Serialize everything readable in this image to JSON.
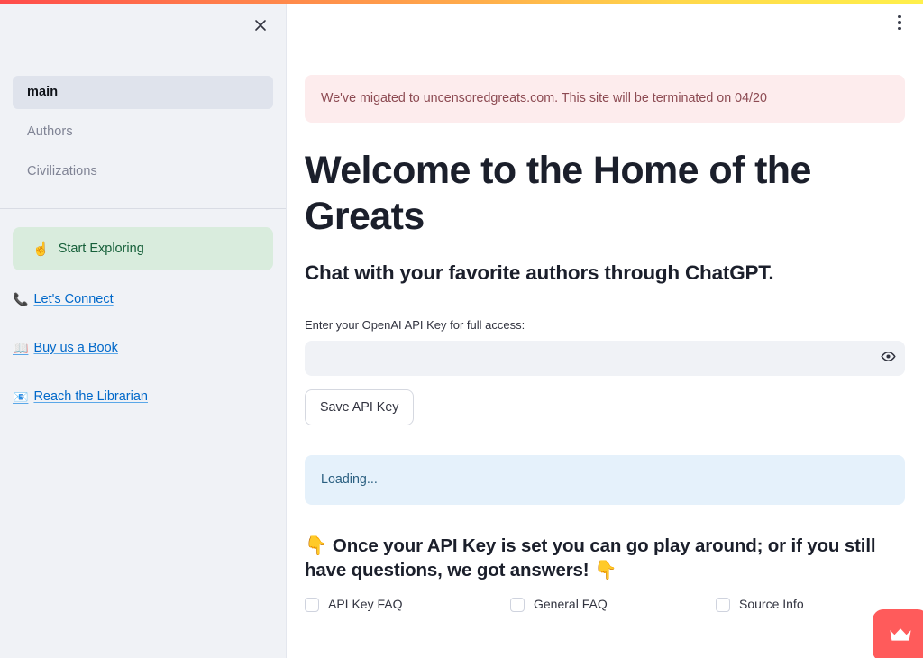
{
  "window": {
    "accent_gradient_start": "#ff4b4b",
    "accent_gradient_end": "#fff04b"
  },
  "sidebar": {
    "close_label": "×",
    "nav_items": [
      {
        "label": "main",
        "active": true
      },
      {
        "label": "Authors",
        "active": false
      },
      {
        "label": "Civilizations",
        "active": false
      }
    ],
    "success_box": {
      "emoji": "☝️",
      "text": "Start Exploring",
      "bg_color": "#d9ecdd",
      "text_color": "#17603a"
    },
    "links": [
      {
        "emoji": "📞",
        "label": "Let's Connect"
      },
      {
        "emoji": "📖",
        "label": "Buy us a Book"
      },
      {
        "emoji": "📧",
        "label": "Reach the Librarian"
      }
    ],
    "link_color": "#0068c9"
  },
  "main": {
    "menu_icon": "three-dots-vertical",
    "alert": {
      "text": "We've migated to uncensoredgreats.com. This site will be terminated on 04/20",
      "bg_color": "#fdeced",
      "text_color": "#8c4a52"
    },
    "title": "Welcome to the Home of the Greats",
    "subtitle": "Chat with your favorite authors through ChatGPT.",
    "api_key": {
      "label": "Enter your OpenAI API Key for full access:",
      "value": "",
      "placeholder": "",
      "reveal_icon": "eye-icon",
      "save_label": "Save API Key"
    },
    "status": {
      "text": "Loading...",
      "bg_color": "#e5f1fb",
      "text_color": "#2a5f80"
    },
    "cta_heading": {
      "emoji_leading": "👇",
      "text": "Once your API Key is set you can go play around; or if you still have questions, we got answers!",
      "emoji_trailing": "👇"
    },
    "checkboxes": [
      {
        "label": "API Key FAQ",
        "checked": false
      },
      {
        "label": "General FAQ",
        "checked": false
      },
      {
        "label": "Source Info",
        "checked": false
      }
    ],
    "fab": {
      "icon": "crown-icon",
      "bg_color": "#ff5b5b"
    }
  }
}
